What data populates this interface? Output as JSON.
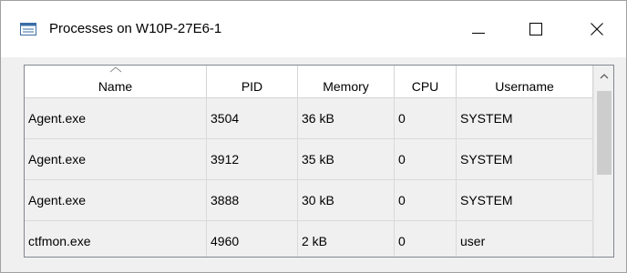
{
  "window": {
    "title": "Processes on W10P-27E6-1",
    "app_icon": "process-list-icon",
    "controls": [
      "minimize-icon",
      "maximize-icon",
      "close-icon"
    ]
  },
  "table": {
    "sorted_column": "Name",
    "columns": [
      "Name",
      "PID",
      "Memory",
      "CPU",
      "Username"
    ],
    "rows": [
      [
        "Agent.exe",
        "3504",
        "36 kB",
        "0",
        "SYSTEM"
      ],
      [
        "Agent.exe",
        "3912",
        "35 kB",
        "0",
        "SYSTEM"
      ],
      [
        "Agent.exe",
        "3888",
        "30 kB",
        "0",
        "SYSTEM"
      ],
      [
        "ctfmon.exe",
        "4960",
        "2 kB",
        "0",
        "user"
      ]
    ]
  },
  "colors": {
    "titlebar_bg": "#ffffff",
    "grid_bg": "#f0f0f0",
    "grid_lines": "#dadada",
    "scroll_thumb": "#cdcdcd"
  }
}
